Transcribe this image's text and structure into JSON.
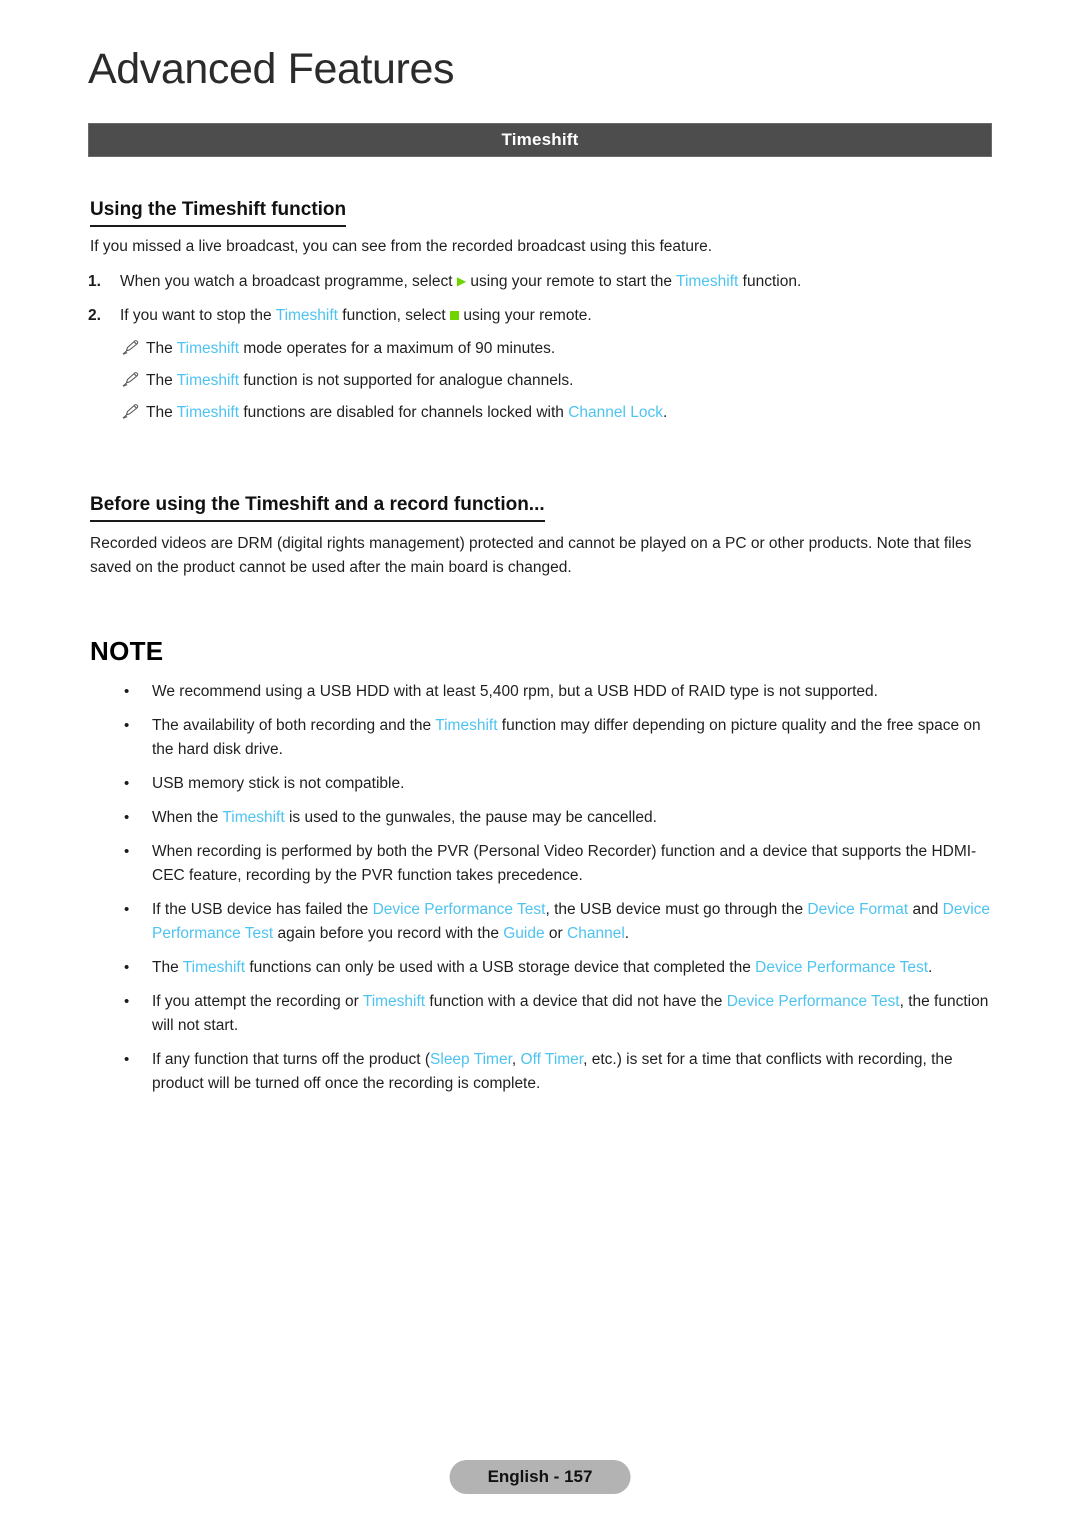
{
  "chapter": {
    "title": "Advanced Features"
  },
  "banner": {
    "label": "Timeshift"
  },
  "sections": {
    "using": {
      "heading": "Using the Timeshift function",
      "intro": "If you missed a live broadcast, you can see from the recorded broadcast using this feature.",
      "steps": [
        {
          "number": "1.",
          "text_before_glyph": "When you watch a broadcast programme, select",
          "glyph": "play-icon",
          "text_after_glyph": "using your remote to start the",
          "keyword": "Timeshift",
          "text_end": "function."
        },
        {
          "number": "2.",
          "text_before_keyword": "If you want to stop the",
          "keyword": "Timeshift",
          "text_after_keyword": "function, select",
          "glyph": "stop-icon",
          "text_end": "using your remote."
        }
      ],
      "notes": [
        {
          "icon": "pencil-note-icon",
          "prefix": "The",
          "keyword": "Timeshift",
          "suffix": "mode operates for a maximum of 90 minutes."
        },
        {
          "icon": "pencil-note-icon",
          "prefix": "The",
          "keyword": "Timeshift",
          "suffix": "function is not supported for analogue channels."
        },
        {
          "icon": "pencil-note-icon",
          "prefix": "The",
          "keyword": "Timeshift",
          "suffix": "functions are disabled for channels locked with",
          "keyword2": "Channel Lock",
          "suffix2": "."
        }
      ]
    },
    "before": {
      "heading": "Before using the Timeshift and a record function...",
      "paragraph": "Recorded videos are DRM (digital rights management) protected and cannot be played on a PC or other products. Note that files saved on the product cannot be used after the main board is changed."
    },
    "note": {
      "heading": "NOTE",
      "bullet_marker": "•",
      "bullets": [
        {
          "segments": [
            {
              "type": "plain",
              "text": "We recommend using a USB HDD with at least 5,400 rpm, but a USB HDD of RAID type is not supported."
            }
          ]
        },
        {
          "segments": [
            {
              "type": "plain",
              "text": "The availability of both recording and the "
            },
            {
              "type": "keyword",
              "text": "Timeshift"
            },
            {
              "type": "plain",
              "text": " function may differ depending on picture quality and the free space on the hard disk drive."
            }
          ]
        },
        {
          "segments": [
            {
              "type": "plain",
              "text": "USB memory stick is not compatible."
            }
          ]
        },
        {
          "segments": [
            {
              "type": "plain",
              "text": "When the "
            },
            {
              "type": "keyword",
              "text": "Timeshift"
            },
            {
              "type": "plain",
              "text": " is used to the gunwales, the pause may be cancelled."
            }
          ]
        },
        {
          "segments": [
            {
              "type": "plain",
              "text": "When recording is performed by both the PVR (Personal Video Recorder) function and a device that supports the HDMI-CEC feature, recording by the PVR function takes precedence."
            }
          ]
        },
        {
          "segments": [
            {
              "type": "plain",
              "text": "If the USB device has failed the "
            },
            {
              "type": "keyword",
              "text": "Device Performance Test"
            },
            {
              "type": "plain",
              "text": ", the USB device must go through the "
            },
            {
              "type": "keyword",
              "text": "Device Format"
            },
            {
              "type": "plain",
              "text": " and "
            },
            {
              "type": "keyword",
              "text": "Device Performance Test"
            },
            {
              "type": "plain",
              "text": " again before you record with the "
            },
            {
              "type": "keyword",
              "text": "Guide"
            },
            {
              "type": "plain",
              "text": " or "
            },
            {
              "type": "keyword",
              "text": "Channel"
            },
            {
              "type": "plain",
              "text": "."
            }
          ]
        },
        {
          "segments": [
            {
              "type": "plain",
              "text": "The "
            },
            {
              "type": "keyword",
              "text": "Timeshift"
            },
            {
              "type": "plain",
              "text": " functions can only be used with a USB storage device that completed the "
            },
            {
              "type": "keyword",
              "text": "Device Performance Test"
            },
            {
              "type": "plain",
              "text": "."
            }
          ]
        },
        {
          "segments": [
            {
              "type": "plain",
              "text": "If you attempt the recording or "
            },
            {
              "type": "keyword",
              "text": "Timeshift"
            },
            {
              "type": "plain",
              "text": " function with a device that did not have the "
            },
            {
              "type": "keyword",
              "text": "Device Performance Test"
            },
            {
              "type": "plain",
              "text": ", the function will not start."
            }
          ]
        },
        {
          "segments": [
            {
              "type": "plain",
              "text": "If any function that turns off the product ("
            },
            {
              "type": "keyword",
              "text": "Sleep Timer"
            },
            {
              "type": "plain",
              "text": ", "
            },
            {
              "type": "keyword",
              "text": "Off Timer"
            },
            {
              "type": "plain",
              "text": ", etc.) is set for a time that conflicts with recording, the product will be turned off once the recording is complete."
            }
          ]
        }
      ]
    }
  },
  "footer": {
    "label": "English - 157"
  },
  "colors": {
    "keyword_cyan": "#4ec3f0",
    "remote_green": "#6fd400",
    "banner_grey": "#4d4d4d",
    "footer_pill_grey": "#b3b3b3"
  }
}
